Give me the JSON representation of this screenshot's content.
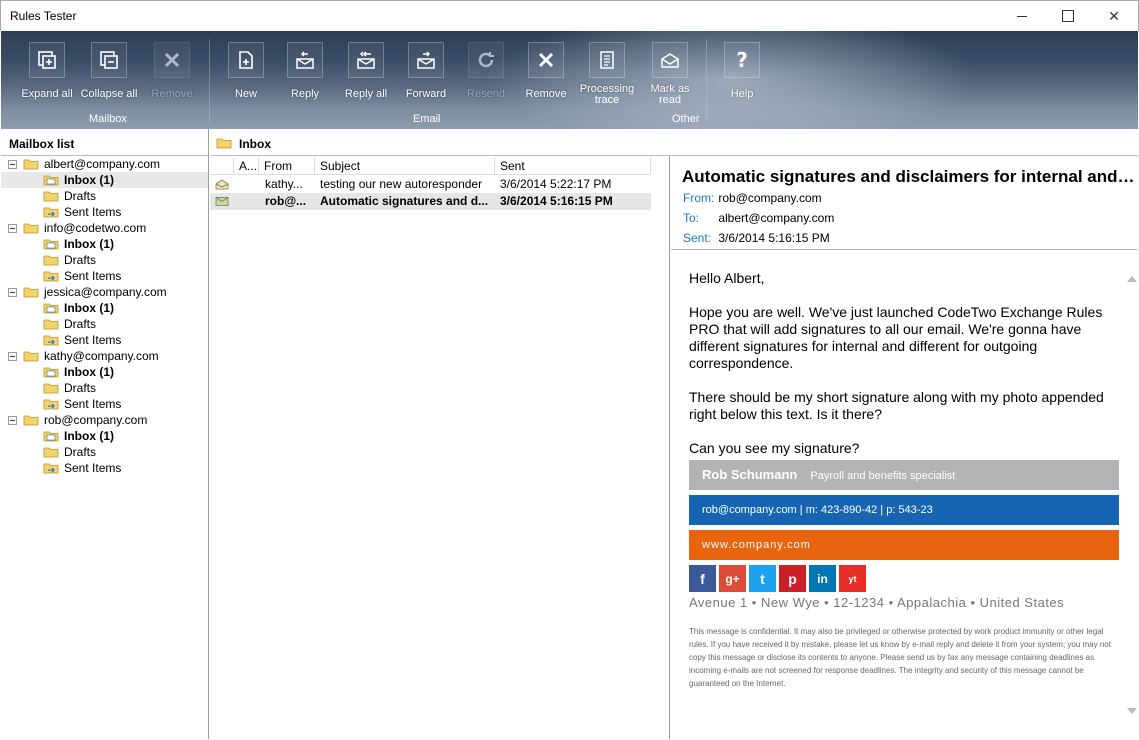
{
  "window": {
    "title": "Rules Tester"
  },
  "ribbon": {
    "groups": {
      "mailbox": "Mailbox",
      "email": "Email",
      "other": "Other"
    },
    "buttons": {
      "expand_all": "Expand all",
      "collapse_all": "Collapse all",
      "remove_mailbox": "Remove",
      "new": "New",
      "reply": "Reply",
      "reply_all": "Reply all",
      "forward": "Forward",
      "resend": "Resend",
      "remove_email": "Remove",
      "processing_trace_1": "Processing",
      "processing_trace_2": "trace",
      "mark_as_read_1": "Mark as",
      "mark_as_read_2": "read",
      "help": "Help"
    }
  },
  "mailbox_list": {
    "title": "Mailbox list",
    "accounts": [
      {
        "name": "albert@company.com",
        "inbox": "Inbox (1)",
        "drafts": "Drafts",
        "sent": "Sent Items"
      },
      {
        "name": "info@codetwo.com",
        "inbox": "Inbox (1)",
        "drafts": "Drafts",
        "sent": "Sent Items"
      },
      {
        "name": "jessica@company.com",
        "inbox": "Inbox (1)",
        "drafts": "Drafts",
        "sent": "Sent Items"
      },
      {
        "name": "kathy@company.com",
        "inbox": "Inbox (1)",
        "drafts": "Drafts",
        "sent": "Sent Items"
      },
      {
        "name": "rob@company.com",
        "inbox": "Inbox (1)",
        "drafts": "Drafts",
        "sent": "Sent Items"
      }
    ]
  },
  "message_list": {
    "folder": "Inbox",
    "columns": {
      "attach": "A...",
      "from": "From",
      "subject": "Subject",
      "sent": "Sent"
    },
    "rows": [
      {
        "from": "kathy...",
        "subject": "testing our new autoresponder",
        "sent": "3/6/2014 5:22:17 PM"
      },
      {
        "from": "rob@...",
        "subject": "Automatic signatures and d...",
        "sent": "3/6/2014 5:16:15 PM"
      }
    ]
  },
  "reading_pane": {
    "subject": "Automatic signatures and disclaimers for internal and o...",
    "from_label": "From:",
    "from": "rob@company.com",
    "to_label": "To:",
    "to": "albert@company.com",
    "sent_label": "Sent:",
    "sent": "3/6/2014 5:16:15 PM",
    "body": {
      "greeting": "Hello Albert,",
      "p1": "Hope you are well. We've just launched CodeTwo Exchange Rules PRO that will add signatures to all our email. We're gonna have different signatures for internal and different for outgoing correspondence.",
      "p2": "There should be my short signature along with my photo appended right below this text. Is it there?",
      "p3": "Can you see my signature?"
    },
    "signature": {
      "name": "Rob Schumann",
      "position": "Payroll and benefits specialist",
      "contact": "rob@company.com |  m:  423-890-42 | p: 543-23",
      "website": "www.company.com",
      "address": "Avenue 1 • New Wye  • 12-1234 • Appalachia • United States",
      "social": [
        "f",
        "g+",
        "t",
        "p",
        "in",
        "yt"
      ]
    },
    "disclaimer": "This message is confidential. It may also be privileged or otherwise protected by work product immunity or other legal rules. If you have received it by mistake, please let us know by e-mail reply and delete it from your system; you may not copy this message or disclose its contents to anyone. Please send us by fax any message containing deadlines as incoming e-mails are not screened for response deadlines. The integrity and security of this message cannot be guaranteed on the Internet."
  },
  "colors": {
    "ribbon_dark": "#2e3f55",
    "header_label_blue": "#1e76c8",
    "sig_gray": "#b3b3b3",
    "sig_blue": "#1665b3",
    "sig_orange": "#e8640f",
    "facebook": "#3b5998",
    "google_plus": "#dd4b39",
    "twitter": "#1da1f2",
    "pinterest": "#cb2027",
    "linkedin": "#0077b5",
    "youtube": "#e52d27"
  }
}
